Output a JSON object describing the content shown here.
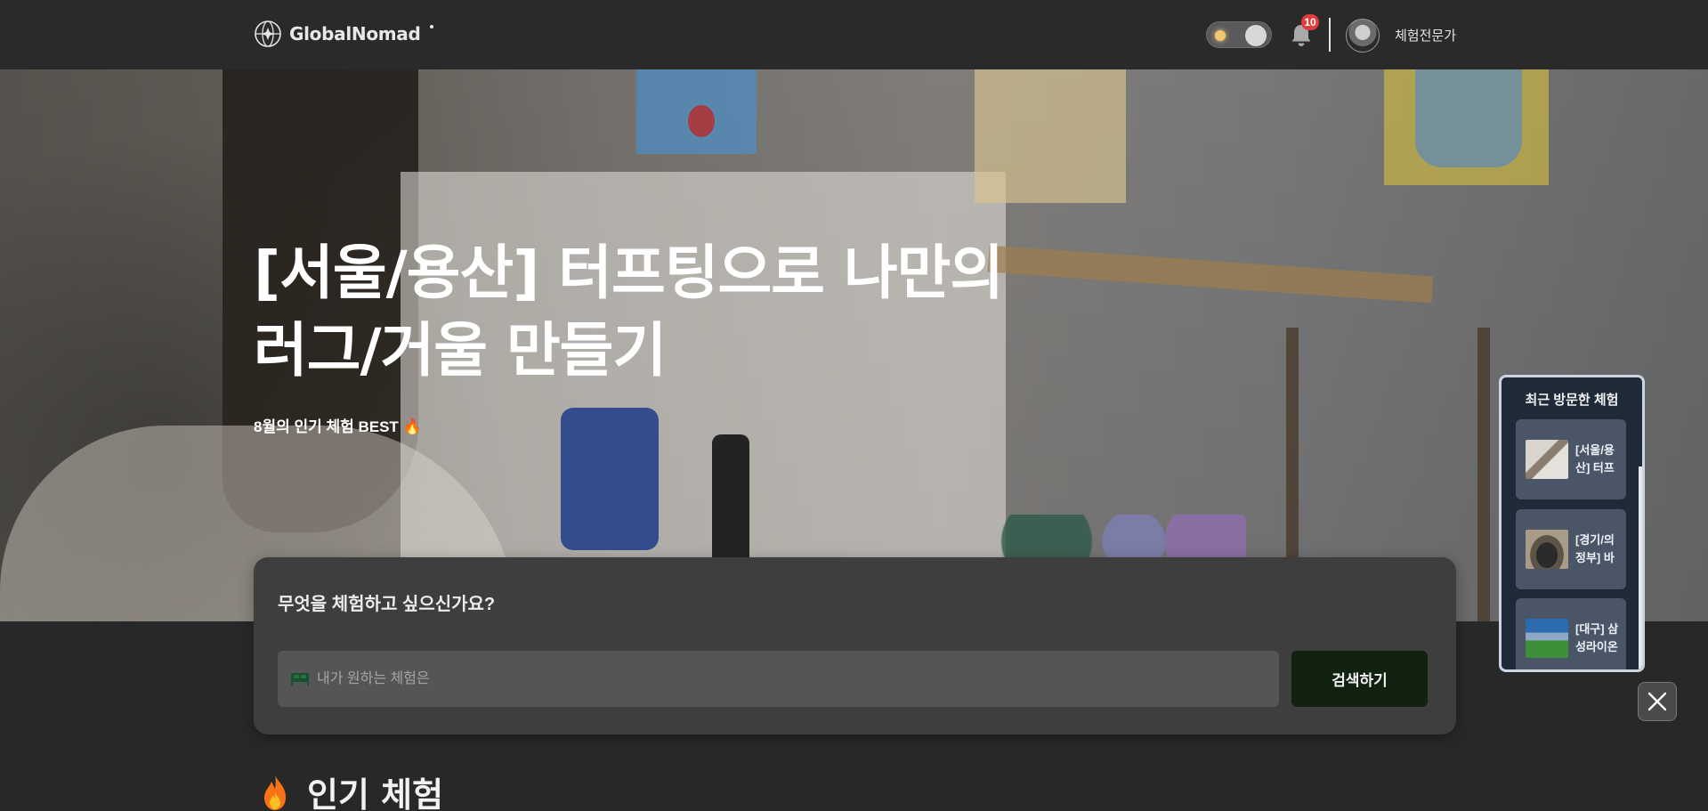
{
  "header": {
    "logo_text": "GlobalNomad",
    "notification_count": "10",
    "user_name": "체험전문가"
  },
  "hero": {
    "title": "[서울/용산] 터프팅으로 나만의 러그/거울 만들기",
    "subtitle": "8월의 인기 체험 BEST 🔥"
  },
  "search": {
    "title": "무엇을 체험하고 싶으신가요?",
    "placeholder": "내가 원하는 체험은",
    "value": "",
    "button_label": "검색하기"
  },
  "popular": {
    "heading": "인기 체험"
  },
  "recent_panel": {
    "title": "최근 방문한 체험",
    "items": [
      {
        "label": "[서울/용산] 터프팅으로 나..."
      },
      {
        "label": "[경기/의정부] 바리스타 커..."
      },
      {
        "label": "[대구] 삼성라이온즈 파크 ..."
      }
    ]
  },
  "icons": {
    "logo": "globe-icon",
    "bell": "bell-icon",
    "bed": "bed-icon",
    "fire": "fire-icon",
    "close": "close-icon"
  },
  "colors": {
    "header_bg": "#2a2a2a",
    "page_bg": "#282828",
    "search_card_bg": "#3e3e3e",
    "search_button_bg": "#112211",
    "badge": "#e23b3b",
    "recent_panel_bg": "#1f2937"
  }
}
